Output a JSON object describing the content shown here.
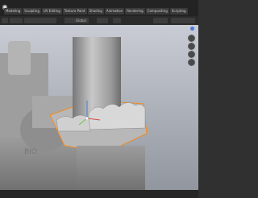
{
  "tabs": [
    "Modeling",
    "Sculpting",
    "UV Editing",
    "Texture Paint",
    "Shading",
    "Animation",
    "Rendering",
    "Compositing",
    "Scripting"
  ],
  "header": {
    "view_mode": "Global"
  },
  "icons": {
    "logo": "blender-logo-icon",
    "gizmo": [
      "zoom-icon",
      "pan-icon",
      "camera-icon",
      "grid-icon"
    ]
  },
  "colors": {
    "ui_dark": "#232323",
    "viewport_top": "#c9ccd4",
    "viewport_bottom": "#8f949c",
    "selection_outline": "#f08a24",
    "gizmo_x": "#e04b4b",
    "gizmo_y": "#6fc24a",
    "gizmo_z": "#4c7ce0"
  }
}
